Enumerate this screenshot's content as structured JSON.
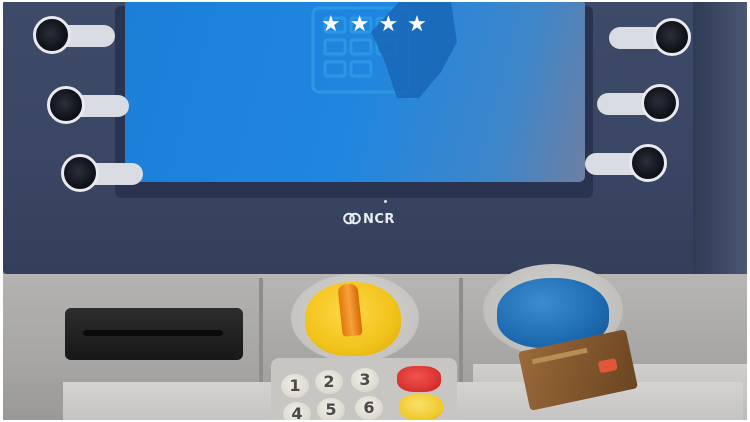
{
  "scene": {
    "subject": "atm",
    "colors": {
      "bezel": "#3a4664",
      "screen": "#1f86e0",
      "fascia": "#a9a8a6",
      "card_reader_yellow": "#f2c31a",
      "card_reader_blue": "#1e6bb2",
      "cancel_key": "#d8302c",
      "clear_key": "#efc92a"
    }
  },
  "screen": {
    "pin_mask": "★★★★",
    "icon": "hand-keypad-icon"
  },
  "brand": {
    "logo_text": "NCR",
    "logo_icon": "ncr-rings-icon"
  },
  "side_keys": {
    "left_count": 3,
    "right_count": 3
  },
  "keypad": {
    "keys": [
      "1",
      "2",
      "3",
      "4",
      "5",
      "6"
    ],
    "function_keys": [
      "cancel-key",
      "clear-key"
    ]
  }
}
